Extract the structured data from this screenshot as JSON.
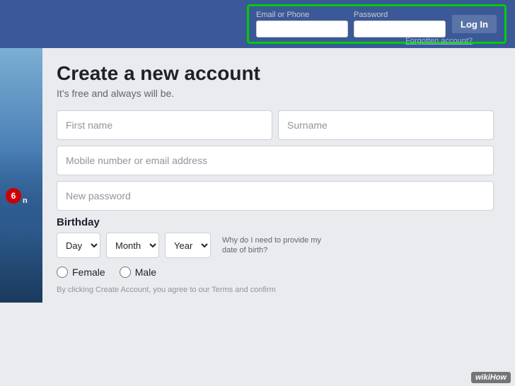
{
  "topNav": {
    "emailLabel": "Email or Phone",
    "passwordLabel": "Password",
    "loginButton": "Log In",
    "forgotLink": "Forgotten account?"
  },
  "form": {
    "title": "Create a new account",
    "subtitle": "It’s free and always will be.",
    "firstNamePlaceholder": "First name",
    "surnamePlaceholder": "Surname",
    "emailPlaceholder": "Mobile number or email address",
    "passwordPlaceholder": "New password",
    "birthday": {
      "label": "Birthday",
      "dayOption": "Day",
      "monthOption": "Month",
      "yearOption": "Year",
      "whyText": "Why do I need to provide my date of birth?"
    },
    "gender": {
      "female": "Female",
      "male": "Male"
    },
    "termsText": "By clicking Create Account, you agree to our Terms and confirm"
  },
  "sidebar": {
    "stepNumber": "6"
  },
  "wikihow": {
    "prefix": "wiki",
    "suffix": "How"
  }
}
